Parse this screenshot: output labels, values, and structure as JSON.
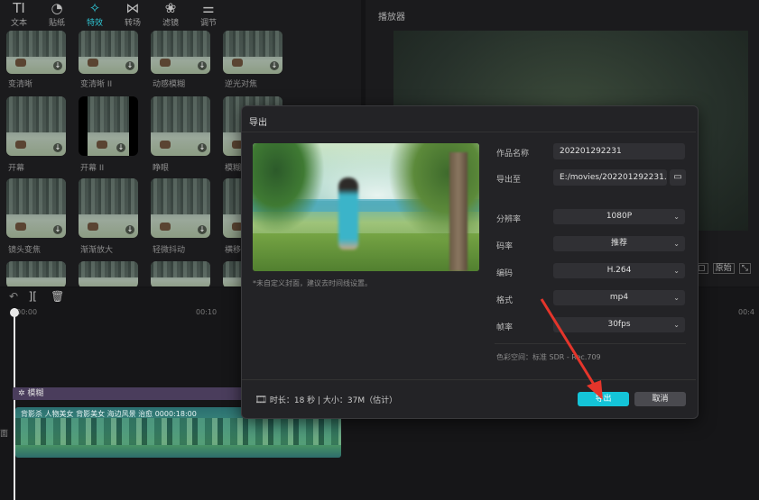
{
  "toolbar": {
    "items": [
      {
        "label": "文本",
        "icon": "text-icon"
      },
      {
        "label": "贴纸",
        "icon": "sticker-icon"
      },
      {
        "label": "特效",
        "icon": "effects-icon",
        "active": true
      },
      {
        "label": "转场",
        "icon": "transition-icon"
      },
      {
        "label": "滤镜",
        "icon": "filter-icon"
      },
      {
        "label": "调节",
        "icon": "adjust-icon"
      }
    ]
  },
  "effects": [
    {
      "label": "变清晰"
    },
    {
      "label": "变清晰 II"
    },
    {
      "label": "动感模糊"
    },
    {
      "label": "逆光对焦"
    },
    {
      "label": "开幕"
    },
    {
      "label": "开幕 II"
    },
    {
      "label": "睁眼"
    },
    {
      "label": "模糊"
    },
    {
      "label": "镜头变焦"
    },
    {
      "label": "渐渐放大"
    },
    {
      "label": "轻微抖动"
    },
    {
      "label": "横移"
    }
  ],
  "player": {
    "title": "播放器",
    "original_label": "原始"
  },
  "timeline": {
    "ruler": [
      "00:00",
      "00:10",
      "00:4"
    ],
    "effect_track_label": "模糊",
    "video_track_label": "背影杀 人物美女  背影美女 海边风景 治愈   0000:18:00",
    "side_tag": "面"
  },
  "dialog": {
    "title": "导出",
    "cover_note": "*未自定义封面，建议去时间线设置。",
    "fields": {
      "name_label": "作品名称",
      "name_value": "202201292231",
      "path_label": "导出至",
      "path_value": "E:/movies/202201292231...",
      "resolution_label": "分辨率",
      "resolution_value": "1080P",
      "bitrate_label": "码率",
      "bitrate_value": "推荐",
      "codec_label": "编码",
      "codec_value": "H.264",
      "format_label": "格式",
      "format_value": "mp4",
      "fps_label": "帧率",
      "fps_value": "30fps"
    },
    "color_space": "色彩空间：标准 SDR - Rec.709",
    "footer_info": "时长：18 秒 | 大小：37M（估计）",
    "export_label": "导出",
    "cancel_label": "取消"
  },
  "colors": {
    "accent": "#14c4d8",
    "arrow": "#e5352b"
  }
}
